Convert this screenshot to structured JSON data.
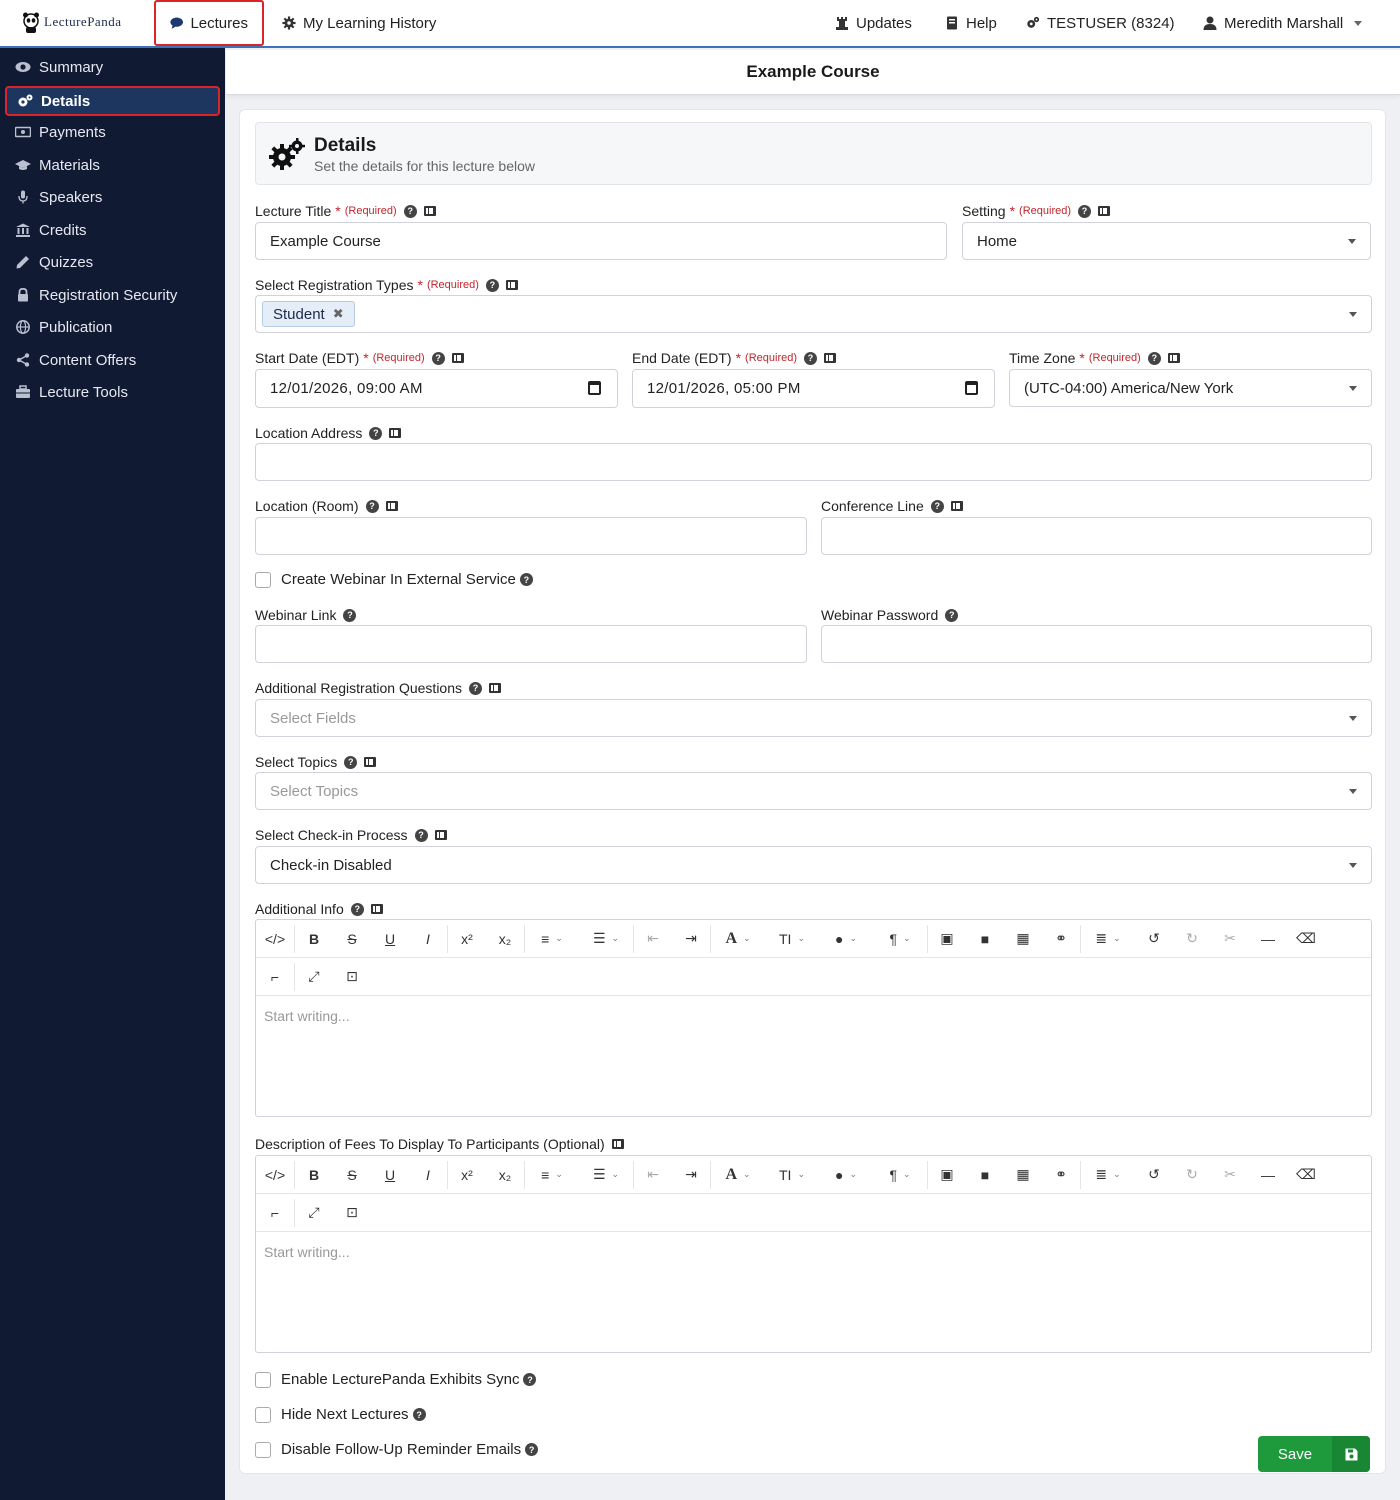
{
  "app": {
    "logo_text": "LecturePanda"
  },
  "topnav": {
    "tabs": [
      {
        "label": "Lectures",
        "icon": "comment-icon"
      },
      {
        "label": "My Learning History",
        "icon": "gear-icon"
      }
    ],
    "right": [
      {
        "label": "Updates",
        "icon": "chess-rook-icon"
      },
      {
        "label": "Help",
        "icon": "book-icon"
      },
      {
        "label": "TESTUSER (8324)",
        "icon": "gears-icon"
      },
      {
        "label": "Meredith Marshall",
        "icon": "user-icon"
      }
    ]
  },
  "sidebar": {
    "items": [
      {
        "label": "Summary",
        "icon": "eye-icon"
      },
      {
        "label": "Details",
        "icon": "gears-icon",
        "active": true
      },
      {
        "label": "Payments",
        "icon": "money-bill-icon"
      },
      {
        "label": "Materials",
        "icon": "graduation-cap-icon"
      },
      {
        "label": "Speakers",
        "icon": "microphone-icon"
      },
      {
        "label": "Credits",
        "icon": "bank-icon"
      },
      {
        "label": "Quizzes",
        "icon": "pencil-icon"
      },
      {
        "label": "Registration Security",
        "icon": "lock-icon"
      },
      {
        "label": "Publication",
        "icon": "globe-icon"
      },
      {
        "label": "Content Offers",
        "icon": "share-icon"
      },
      {
        "label": "Lecture Tools",
        "icon": "toolbox-icon"
      }
    ]
  },
  "page": {
    "title": "Example Course"
  },
  "section": {
    "title": "Details",
    "subtitle": "Set the details for this lecture below"
  },
  "form": {
    "required_text": "(Required)",
    "lecture_title": {
      "label": "Lecture Title",
      "value": "Example Course"
    },
    "setting": {
      "label": "Setting",
      "value": "Home"
    },
    "registration_types": {
      "label": "Select Registration Types",
      "chips": [
        "Student"
      ]
    },
    "start_date": {
      "label": "Start Date (EDT)",
      "value": "12/01/2026, 09:00 AM"
    },
    "end_date": {
      "label": "End Date (EDT)",
      "value": "12/01/2026, 05:00 PM"
    },
    "time_zone": {
      "label": "Time Zone",
      "value": "(UTC-04:00) America/New York"
    },
    "location_address": {
      "label": "Location Address",
      "value": ""
    },
    "location_room": {
      "label": "Location (Room)",
      "value": ""
    },
    "conference_line": {
      "label": "Conference Line",
      "value": ""
    },
    "create_webinar": {
      "label": "Create Webinar In External Service",
      "checked": false
    },
    "webinar_link": {
      "label": "Webinar Link",
      "value": ""
    },
    "webinar_password": {
      "label": "Webinar Password",
      "value": ""
    },
    "additional_questions": {
      "label": "Additional Registration Questions",
      "placeholder": "Select Fields"
    },
    "topics": {
      "label": "Select Topics",
      "placeholder": "Select Topics"
    },
    "checkin": {
      "label": "Select Check-in Process",
      "value": "Check-in Disabled"
    },
    "additional_info": {
      "label": "Additional Info",
      "placeholder": "Start writing..."
    },
    "fees_description": {
      "label": "Description of Fees To Display To Participants (Optional)",
      "placeholder": "Start writing..."
    },
    "exhibits_sync": {
      "label": "Enable LecturePanda Exhibits Sync",
      "checked": false
    },
    "hide_next": {
      "label": "Hide Next Lectures",
      "checked": false
    },
    "disable_reminders": {
      "label": "Disable Follow-Up Reminder Emails",
      "checked": false
    },
    "save_label": "Save"
  },
  "editor_toolbar": {
    "row1": [
      "code-view-icon",
      "bold-icon",
      "strikethrough-icon",
      "underline-icon",
      "italic-icon",
      "superscript-icon",
      "subscript-icon",
      "bullet-list-icon",
      "numbered-list-icon",
      "outdent-icon",
      "indent-icon",
      "font-family-icon",
      "font-size-icon",
      "text-color-icon",
      "paragraph-format-icon",
      "image-icon",
      "video-icon",
      "table-icon",
      "link-icon",
      "align-icon",
      "undo-icon",
      "redo-icon",
      "cut-icon",
      "horizontal-line-icon",
      "clear-format-icon"
    ],
    "row2": [
      "format-painter-icon",
      "fullscreen-icon",
      "select-all-icon"
    ],
    "glyphs": {
      "bold": "B",
      "strike": "S",
      "underline": "U",
      "italic": "I",
      "sup": "x²",
      "sub": "x₂",
      "font": "A",
      "size": "TI",
      "para": "¶"
    }
  },
  "colors": {
    "sidebar_bg": "#111a33",
    "highlight_red": "#d9252a",
    "save_green": "#1e9a3c",
    "required_red": "#c0262c"
  }
}
